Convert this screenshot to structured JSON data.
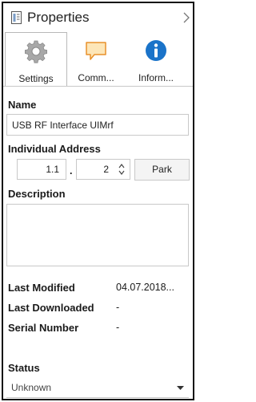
{
  "panel": {
    "title": "Properties",
    "icon": "document-properties-icon",
    "collapse_icon": "chevron-right-icon"
  },
  "tabs": [
    {
      "label": "Settings",
      "icon": "gear-icon",
      "active": true
    },
    {
      "label": "Comm...",
      "icon": "comment-icon",
      "active": false
    },
    {
      "label": "Inform...",
      "icon": "info-icon",
      "active": false
    }
  ],
  "fields": {
    "name_label": "Name",
    "name_value": "USB RF Interface UIMrf",
    "address_label": "Individual Address",
    "address_area": "1.1",
    "address_separator": ".",
    "address_device": "2",
    "park_button": "Park",
    "description_label": "Description",
    "description_value": ""
  },
  "info": {
    "last_modified_label": "Last Modified",
    "last_modified_value": "04.07.2018...",
    "last_downloaded_label": "Last Downloaded",
    "last_downloaded_value": "-",
    "serial_number_label": "Serial Number",
    "serial_number_value": "-"
  },
  "status": {
    "label": "Status",
    "selected": "Unknown"
  },
  "colors": {
    "info_blue": "#1a73c9",
    "comment_orange": "#e8912b",
    "gear_gray": "#9a9a9a"
  }
}
